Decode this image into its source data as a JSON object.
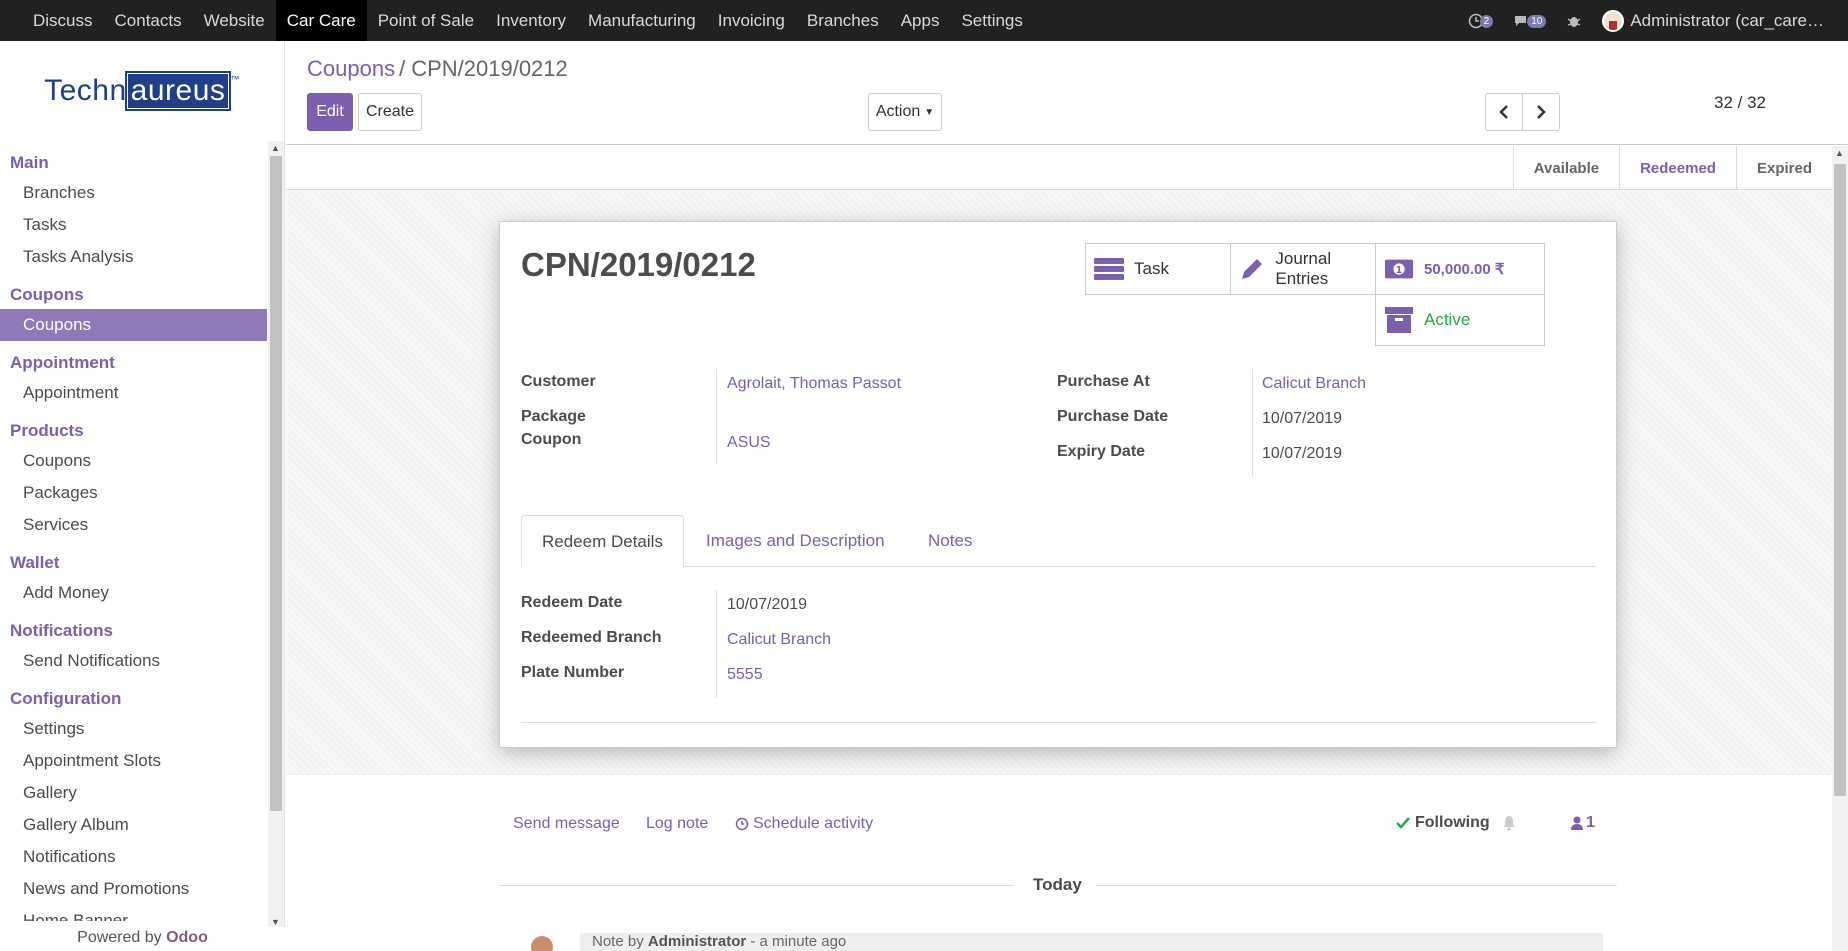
{
  "topbar": {
    "menus": [
      "Discuss",
      "Contacts",
      "Website",
      "Car Care",
      "Point of Sale",
      "Inventory",
      "Manufacturing",
      "Invoicing",
      "Branches",
      "Apps",
      "Settings"
    ],
    "active_menu": "Car Care",
    "activity_count": "2",
    "messages_count": "10",
    "user": "Administrator (car_care…"
  },
  "sidebar": {
    "logo": {
      "left": "Techn",
      "right": "aureus",
      "tm": "™"
    },
    "sections": [
      {
        "title": "Main",
        "items": [
          "Branches",
          "Tasks",
          "Tasks Analysis"
        ]
      },
      {
        "title": "Coupons",
        "items": [
          "Coupons"
        ]
      },
      {
        "title": "Appointment",
        "items": [
          "Appointment"
        ]
      },
      {
        "title": "Products",
        "items": [
          "Coupons",
          "Packages",
          "Services"
        ]
      },
      {
        "title": "Wallet",
        "items": [
          "Add Money"
        ]
      },
      {
        "title": "Notifications",
        "items": [
          "Send Notifications"
        ]
      },
      {
        "title": "Configuration",
        "items": [
          "Settings",
          "Appointment Slots",
          "Gallery",
          "Gallery Album",
          "Notifications",
          "News and Promotions",
          "Home Banner"
        ]
      }
    ],
    "powered_prefix": "Powered by ",
    "powered_brand": "Odoo"
  },
  "control": {
    "breadcrumb_parent": "Coupons",
    "breadcrumb_sep": "/",
    "breadcrumb_current": "CPN/2019/0212",
    "edit_label": "Edit",
    "create_label": "Create",
    "action_label": "Action",
    "pager": "32 / 32"
  },
  "status": {
    "stages": [
      "Available",
      "Redeemed",
      "Expired"
    ],
    "active": "Redeemed"
  },
  "record": {
    "title": "CPN/2019/0212",
    "buttons": {
      "task": "Task",
      "journal": "Journal Entries",
      "amount": "50,000.00 ₹",
      "active": "Active"
    },
    "fields": {
      "customer_label": "Customer",
      "customer": "Agrolait, Thomas Passot",
      "package_label": "Package",
      "coupon_label": "Coupon",
      "package_coupon": "ASUS",
      "purchase_at_label": "Purchase At",
      "purchase_at": "Calicut Branch",
      "purchase_date_label": "Purchase Date",
      "purchase_date": "10/07/2019",
      "expiry_label": "Expiry Date",
      "expiry": "10/07/2019"
    },
    "tabs": [
      "Redeem Details",
      "Images and Description",
      "Notes"
    ],
    "redeem": {
      "date_label": "Redeem Date",
      "date": "10/07/2019",
      "branch_label": "Redeemed Branch",
      "branch": "Calicut Branch",
      "plate_label": "Plate Number",
      "plate": "5555"
    }
  },
  "chatter": {
    "send_message": "Send message",
    "log_note": "Log note",
    "schedule": "Schedule activity",
    "following": "Following",
    "followers": "1",
    "today": "Today",
    "note_prefix": "Note by ",
    "note_author": "Administrator",
    "note_time": " - a minute ago"
  },
  "colors": {
    "accent": "#7c5fad",
    "active_stage": "#7c5fad",
    "active_green": "#28a745"
  }
}
